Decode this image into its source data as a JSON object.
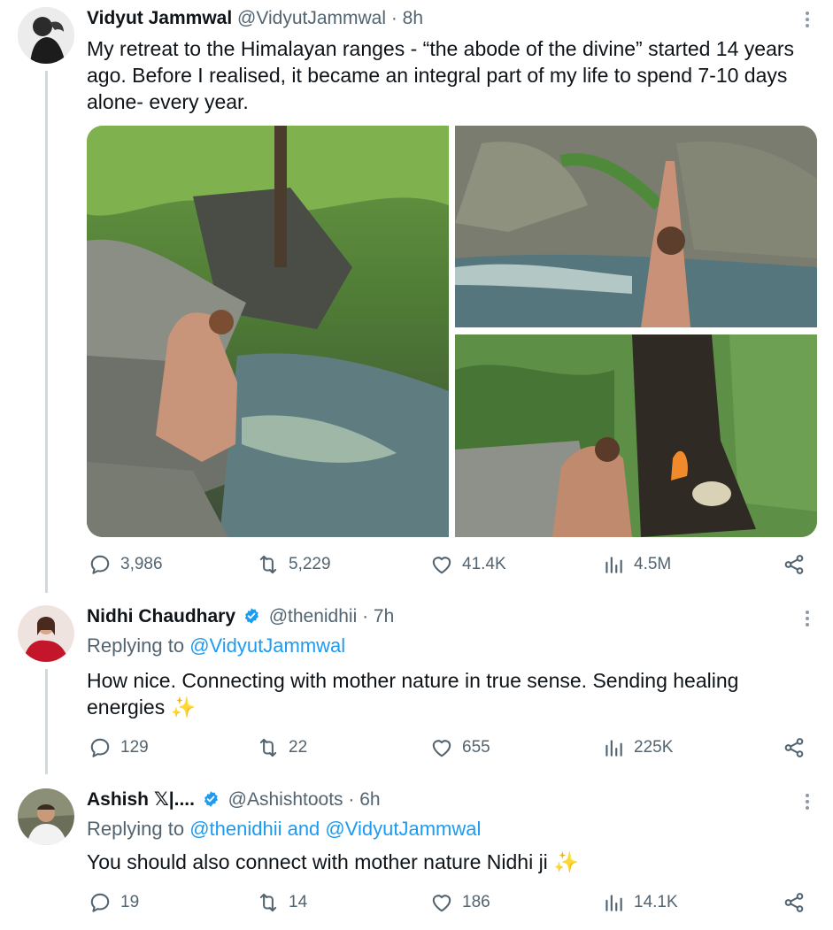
{
  "tweet": {
    "author_name": "Vidyut Jammwal",
    "handle": "@VidyutJammwal",
    "time": "· 8h",
    "text": "My retreat to the Himalayan ranges - “the abode of the divine” started 14 years ago. Before I realised, it became an integral part of my life to spend 7-10 days alone- every year.",
    "stats": {
      "replies": "3,986",
      "retweets": "5,229",
      "likes": "41.4K",
      "views": "4.5M"
    }
  },
  "replies": [
    {
      "author_name": "Nidhi Chaudhary",
      "handle": "@thenidhii",
      "time": "· 7h",
      "replying_prefix": "Replying to ",
      "replying_to": "@VidyutJammwal",
      "text": "How nice. Connecting with mother nature in true sense. Sending healing energies ✨",
      "stats": {
        "replies": "129",
        "retweets": "22",
        "likes": "655",
        "views": "225K"
      }
    },
    {
      "author_name": "Ashish 𝕏|....",
      "handle": "@Ashishtoots",
      "time": "· 6h",
      "replying_prefix": "Replying to ",
      "replying_to": "@thenidhii and @VidyutJammwal",
      "text": "You should also connect with mother nature Nidhi ji ✨",
      "stats": {
        "replies": "19",
        "retweets": "14",
        "likes": "186",
        "views": "14.1K"
      }
    }
  ],
  "icons": {
    "reply": "reply-icon",
    "retweet": "retweet-icon",
    "like": "heart-icon",
    "views": "views-icon",
    "share": "share-icon",
    "more": "more-icon",
    "verified": "verified-badge-icon"
  },
  "colors": {
    "link": "#1d9bf0",
    "secondary_text": "#536471",
    "verified": "#1d9bf0"
  }
}
